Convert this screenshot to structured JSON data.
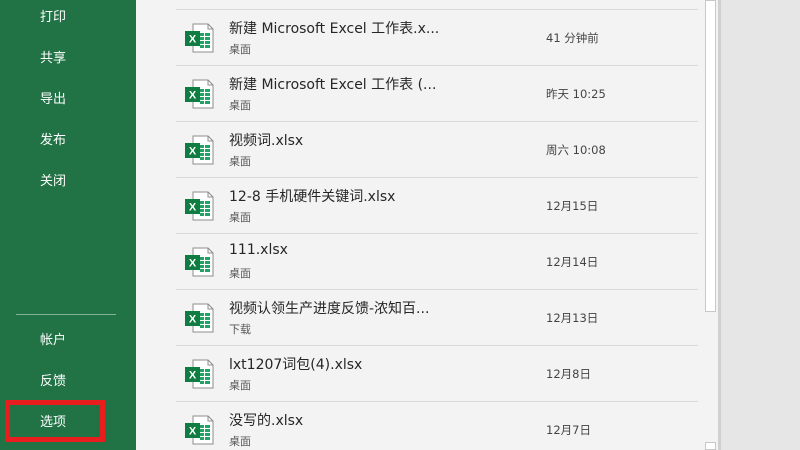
{
  "sidebar": {
    "items": [
      {
        "label": "打印"
      },
      {
        "label": "共享"
      },
      {
        "label": "导出"
      },
      {
        "label": "发布"
      },
      {
        "label": "关闭"
      }
    ],
    "bottom_items": [
      {
        "label": "帐户"
      },
      {
        "label": "反馈"
      },
      {
        "label": "选项"
      }
    ],
    "background_color": "#217346",
    "highlight_color": "#e81d1d"
  },
  "files": [
    {
      "name": "新建 Microsoft Excel 工作表.x...",
      "location": "桌面",
      "time": "41 分钟前",
      "icon": "excel-file-icon"
    },
    {
      "name": "新建 Microsoft Excel 工作表 (...",
      "location": "桌面",
      "time": "昨天 10:25",
      "icon": "excel-file-icon"
    },
    {
      "name": "视频词.xlsx",
      "location": "桌面",
      "time": "周六 10:08",
      "icon": "excel-file-icon"
    },
    {
      "name": "12-8 手机硬件关键词.xlsx",
      "location": "桌面",
      "time": "12月15日",
      "icon": "excel-file-icon"
    },
    {
      "name": "111.xlsx",
      "location": "桌面",
      "time": "12月14日",
      "icon": "excel-file-icon"
    },
    {
      "name": "视频认领生产进度反馈-浓知百...",
      "location": "下载",
      "time": "12月13日",
      "icon": "excel-file-icon"
    },
    {
      "name": "lxt1207词包(4).xlsx",
      "location": "桌面",
      "time": "12月8日",
      "icon": "excel-file-icon"
    },
    {
      "name": "没写的.xlsx",
      "location": "桌面",
      "time": "12月7日",
      "icon": "excel-file-icon"
    }
  ]
}
